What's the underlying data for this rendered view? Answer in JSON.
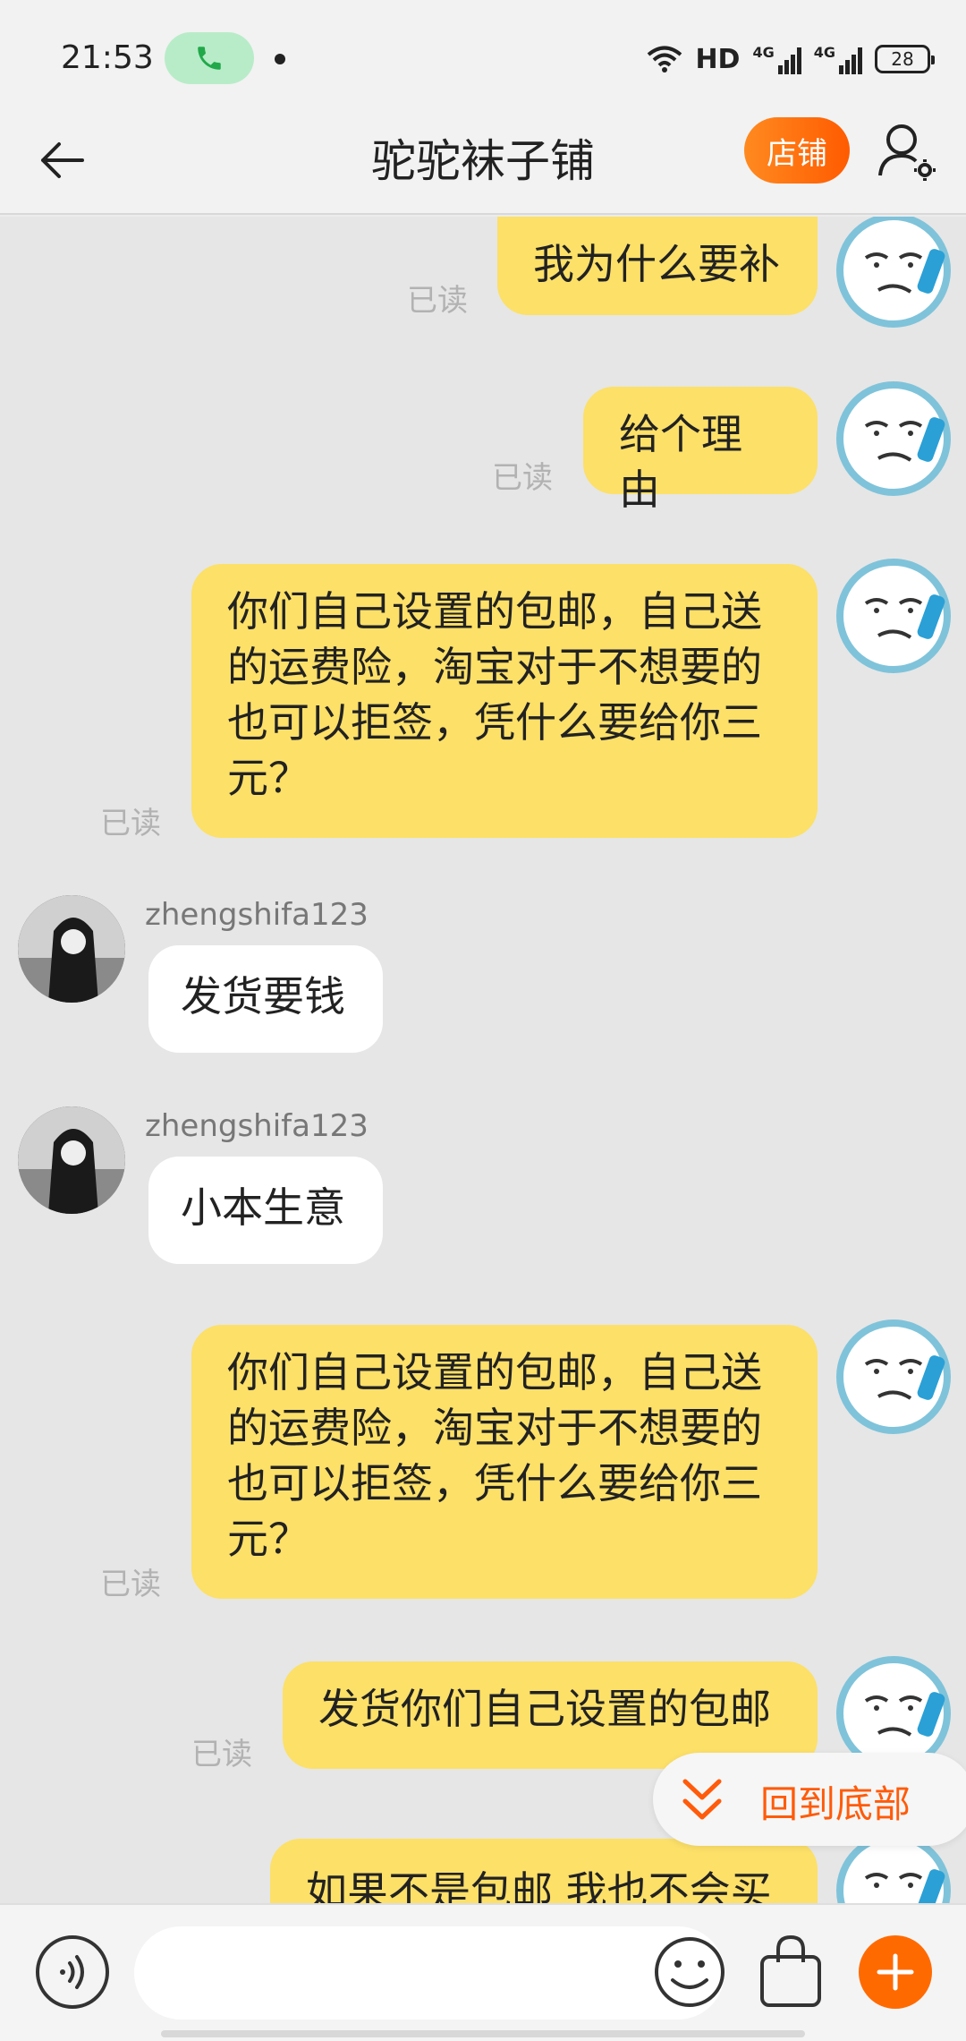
{
  "status_bar": {
    "time": "21:53",
    "hd_label": "HD",
    "network_1": "4G",
    "network_2": "4G",
    "battery": "28",
    "icons": [
      "phone-call-icon",
      "wifi-icon",
      "signal-icon",
      "battery-icon"
    ]
  },
  "header": {
    "title": "驼驼袜子铺",
    "shop_button": "店铺",
    "accent_color": "#ff6a00"
  },
  "messages": [
    {
      "side": "mine",
      "text": "我为什么要补",
      "read": "已读"
    },
    {
      "side": "mine",
      "text": "给个理由",
      "read": "已读"
    },
    {
      "side": "mine",
      "text": "你们自己设置的包邮，自己送的运费险，淘宝对于不想要的也可以拒签，凭什么要给你三元？",
      "read": "已读"
    },
    {
      "side": "theirs",
      "sender": "zhengshifa123",
      "text": "发货要钱"
    },
    {
      "side": "theirs",
      "sender": "zhengshifa123",
      "text": "小本生意"
    },
    {
      "side": "mine",
      "text": "你们自己设置的包邮，自己送的运费险，淘宝对于不想要的也可以拒签，凭什么要给你三元？",
      "read": "已读"
    },
    {
      "side": "mine",
      "text": "发货你们自己设置的包邮",
      "read": "已读"
    },
    {
      "side": "mine",
      "text": "如果不是包邮 我也不会买"
    }
  ],
  "back_to_bottom": "回到底部",
  "input": {
    "placeholder": ""
  },
  "colors": {
    "mine_bubble": "#fce068",
    "theirs_bubble": "#ffffff",
    "chat_bg": "#e6e6e6"
  }
}
